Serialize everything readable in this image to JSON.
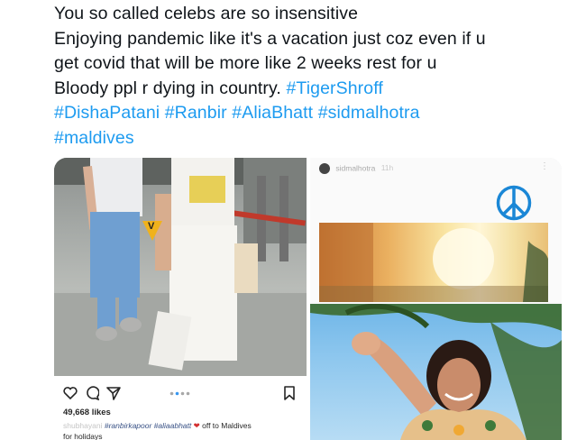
{
  "tweet": {
    "line1": "You so called celebs are so insensitive",
    "line2": "Enjoying pandemic like it's a vacation just coz even if u",
    "line3": "get covid that will be more like 2 weeks rest for u",
    "line4_text": "Bloody ppl r dying in country. ",
    "hashtags": [
      "#TigerShroff",
      "#DishaPatani",
      "#Ranbir",
      "#AliaBhatt",
      "#sidmalhotra",
      "#maldives"
    ]
  },
  "instagram_post": {
    "likes": "49,668 likes",
    "caption_user": "shubhayani",
    "caption_tags": "#ranbirkapoor #aliaabhatt",
    "caption_text": "off to Maldives",
    "caption_text2": "for holidays",
    "watermark": "V",
    "icons": [
      "heart-icon",
      "comment-icon",
      "share-icon",
      "bookmark-icon"
    ],
    "carousel_dots": 4
  },
  "story": {
    "username": "sidmalhotra",
    "time": "11h",
    "sticker": "peace-sign-icon"
  },
  "colors": {
    "hashtag": "#1d9bf0",
    "text": "#0f1419",
    "heart_emoji": "#d32f2f",
    "instagram_blue": "#3897f0"
  }
}
